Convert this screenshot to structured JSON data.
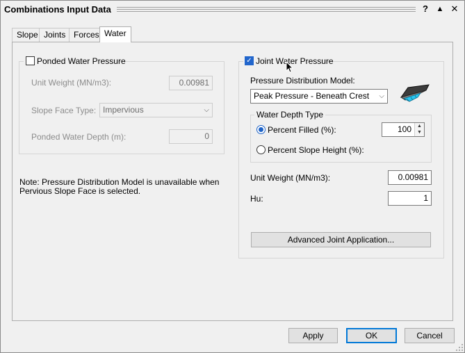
{
  "window": {
    "title": "Combinations Input Data",
    "help_glyph": "?",
    "collapse_glyph": "▲",
    "close_glyph": "✕"
  },
  "tabs": [
    {
      "label": "Slope",
      "active": false
    },
    {
      "label": "Joints",
      "active": false
    },
    {
      "label": "Forces",
      "active": false
    },
    {
      "label": "Water",
      "active": true
    }
  ],
  "ponded": {
    "label": "Ponded Water Pressure",
    "checked": false,
    "unit_weight_label": "Unit Weight (MN/m3):",
    "unit_weight_value": "0.00981",
    "slope_face_label": "Slope Face Type:",
    "slope_face_value": "Impervious",
    "depth_label": "Ponded Water Depth (m):",
    "depth_value": "0"
  },
  "note": "Note: Pressure Distribution Model is unavailable when Pervious Slope Face is selected.",
  "joint": {
    "label": "Joint Water Pressure",
    "checked": true,
    "model_label": "Pressure Distribution Model:",
    "model_value": "Peak Pressure - Beneath Crest",
    "depth_type_label": "Water Depth Type",
    "percent_filled_label": "Percent Filled (%):",
    "percent_filled_value": "100",
    "percent_filled_selected": true,
    "percent_slope_label": "Percent Slope Height (%):",
    "percent_slope_selected": false,
    "unit_weight_label": "Unit Weight (MN/m3):",
    "unit_weight_value": "0.00981",
    "hu_label": "Hu:",
    "hu_value": "1",
    "advanced_label": "Advanced Joint Application..."
  },
  "footer": {
    "apply_label": "Apply",
    "ok_label": "OK",
    "cancel_label": "Cancel"
  },
  "icons": {
    "checkbox_check": "✓",
    "dropdown_arrow": "⌵",
    "spin_up": "▲",
    "spin_down": "▼"
  },
  "colors": {
    "accent": "#0078d7",
    "checkbox_blue": "#2266cc"
  }
}
